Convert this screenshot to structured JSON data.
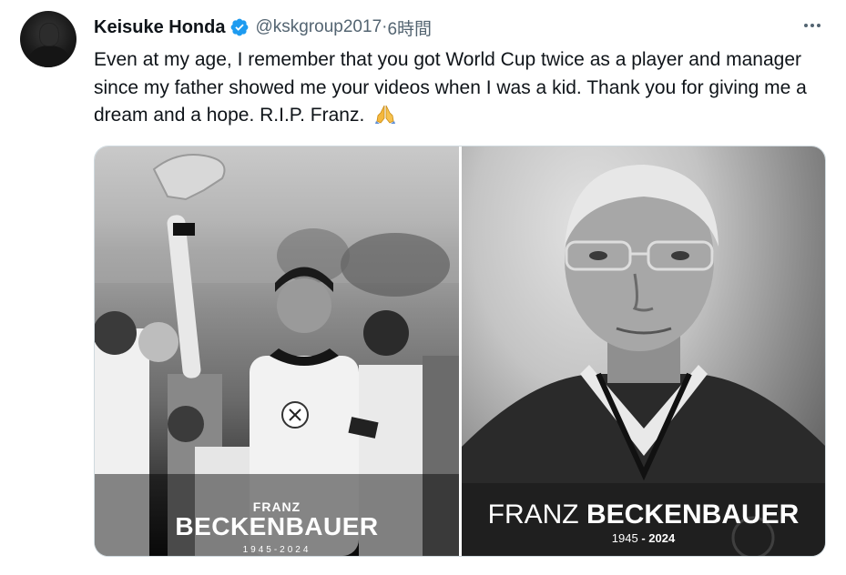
{
  "tweet": {
    "author_name": "Keisuke Honda",
    "handle": "@kskgroup2017",
    "separator": " · ",
    "time": "6時間",
    "text": "Even at my age, I remember that you got World Cup twice as a player and manager since my father showed me your videos when I was a kid. Thank you for giving me a dream and a hope. R.I.P. Franz.",
    "emoji": "folded-hands-icon"
  },
  "media": {
    "left": {
      "first_name": "FRANZ",
      "last_name": "BECKENBAUER",
      "years": "1945-2024"
    },
    "right": {
      "first_name": "FRANZ",
      "last_name": "BECKENBAUER",
      "year_start": "1945",
      "year_sep": " - ",
      "year_end": "2024"
    }
  },
  "colors": {
    "text": "#0f1419",
    "secondary": "#536471",
    "verified": "#1d9bf0",
    "border": "#cfd9de"
  }
}
